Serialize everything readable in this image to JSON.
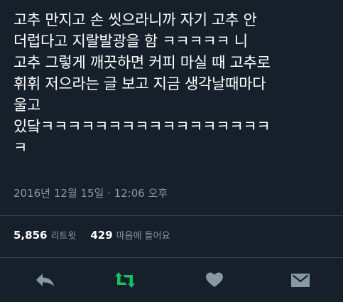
{
  "tweet": {
    "text": "고추 만지고 손 씻으라니까 자기 고추 안\n더럽다고 지랄발광을 함 ㅋㅋㅋㅋㅋ 니\n고추 그렇게 깨끗하면 커피 마실 때 고추로\n휘휘 저으라는 글 보고 지금 생각날때마다\n울고\n있닼ㅋㅋㅋㅋㅋㅋㅋㅋㅋㅋㅋㅋㅋㅋㅋㅋㅋ\nㅋ",
    "timestamp": "2016년 12월 15일 · 12:06 오후"
  },
  "stats": {
    "retweets_count": "5,856",
    "retweets_label": "리트윗",
    "likes_count": "429",
    "likes_label": "마음에 들어요"
  },
  "actions": {
    "reply_icon": "reply-arrow",
    "retweet_icon": "retweet-arrows",
    "like_icon": "heart",
    "message_icon": "envelope"
  },
  "colors": {
    "background": "#15202b",
    "text": "#ffffff",
    "muted": "#8899a6",
    "divider": "#38444d",
    "retweet_active": "#17bf63"
  }
}
